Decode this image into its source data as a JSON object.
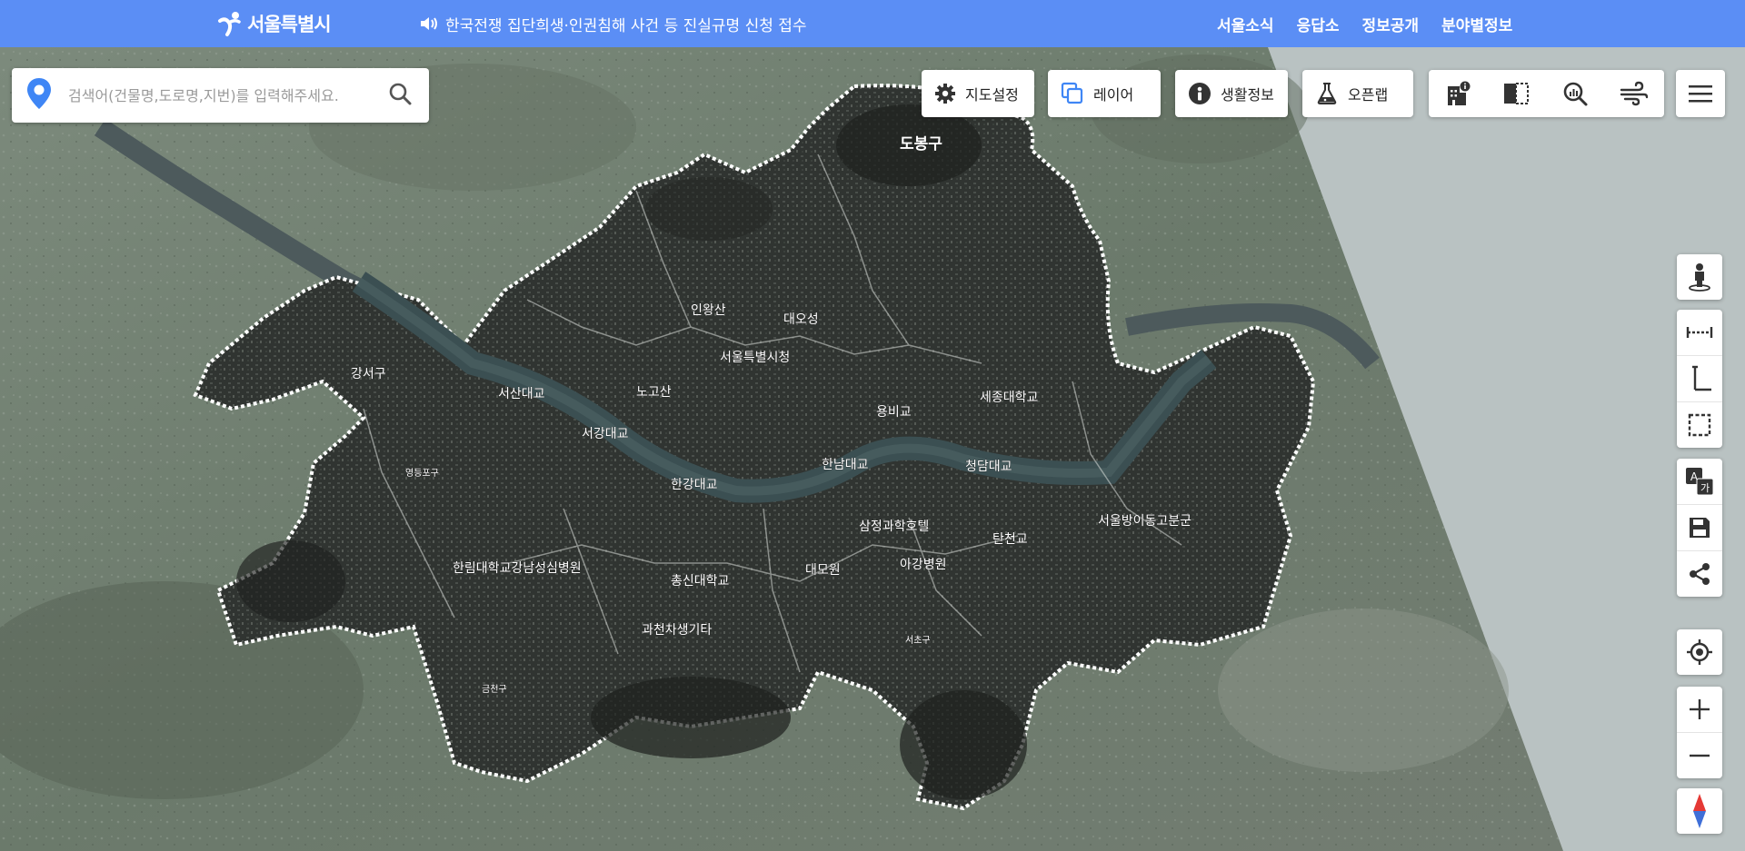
{
  "header": {
    "logo_text": "서울특별시",
    "notice": "한국전쟁 집단희생·인권침해 사건 등 진실규명 신청 접수",
    "nav": [
      "서울소식",
      "응답소",
      "정보공개",
      "분야별정보"
    ]
  },
  "search": {
    "placeholder": "검색어(건물명,도로명,지번)를 입력해주세요."
  },
  "toolbar": {
    "map_settings": "지도설정",
    "layer": "레이어",
    "life_info": "생활정보",
    "open_lab": "오픈랩"
  },
  "tool_icons": [
    "building-info-icon",
    "split-view-icon",
    "zoom-analysis-icon",
    "wind-icon",
    "hamburger-menu-icon"
  ],
  "side_icons": [
    "street-view-icon",
    "distance-measure-icon",
    "height-measure-icon",
    "area-measure-icon",
    "translate-icon",
    "save-icon",
    "share-icon",
    "my-location-icon",
    "zoom-in-icon",
    "zoom-out-icon",
    "compass-icon"
  ],
  "map_labels": {
    "dobong": "도봉구",
    "inwangsan": "인왕산",
    "daeosung": "대오성",
    "cityhall": "서울특별시청",
    "gangseo": "강서구",
    "seogang_univ1": "서산대교",
    "nogosan": "노고산",
    "seogang_bridge": "서강대교",
    "yongbi": "용비교",
    "sejong": "세종대학교",
    "hannam": "한남대교",
    "cheongdam": "청담대교",
    "hangang": "한강대교",
    "samjeong": "삼정과학호텔",
    "tancheon": "탄천교",
    "seoulbang": "서울방이동고분군",
    "hallym": "한림대학교강남성심병원",
    "chongsin": "총신대학교",
    "daemo": "대모원",
    "ahyeon": "아강병원",
    "gwacheon": "과천차생기타",
    "geumcheon": "금천구",
    "yeongdeungpo": "영등포구",
    "seocho": "서초구"
  },
  "colors": {
    "header_bg": "#5b8ef5",
    "pin_blue": "#3f86f5"
  }
}
